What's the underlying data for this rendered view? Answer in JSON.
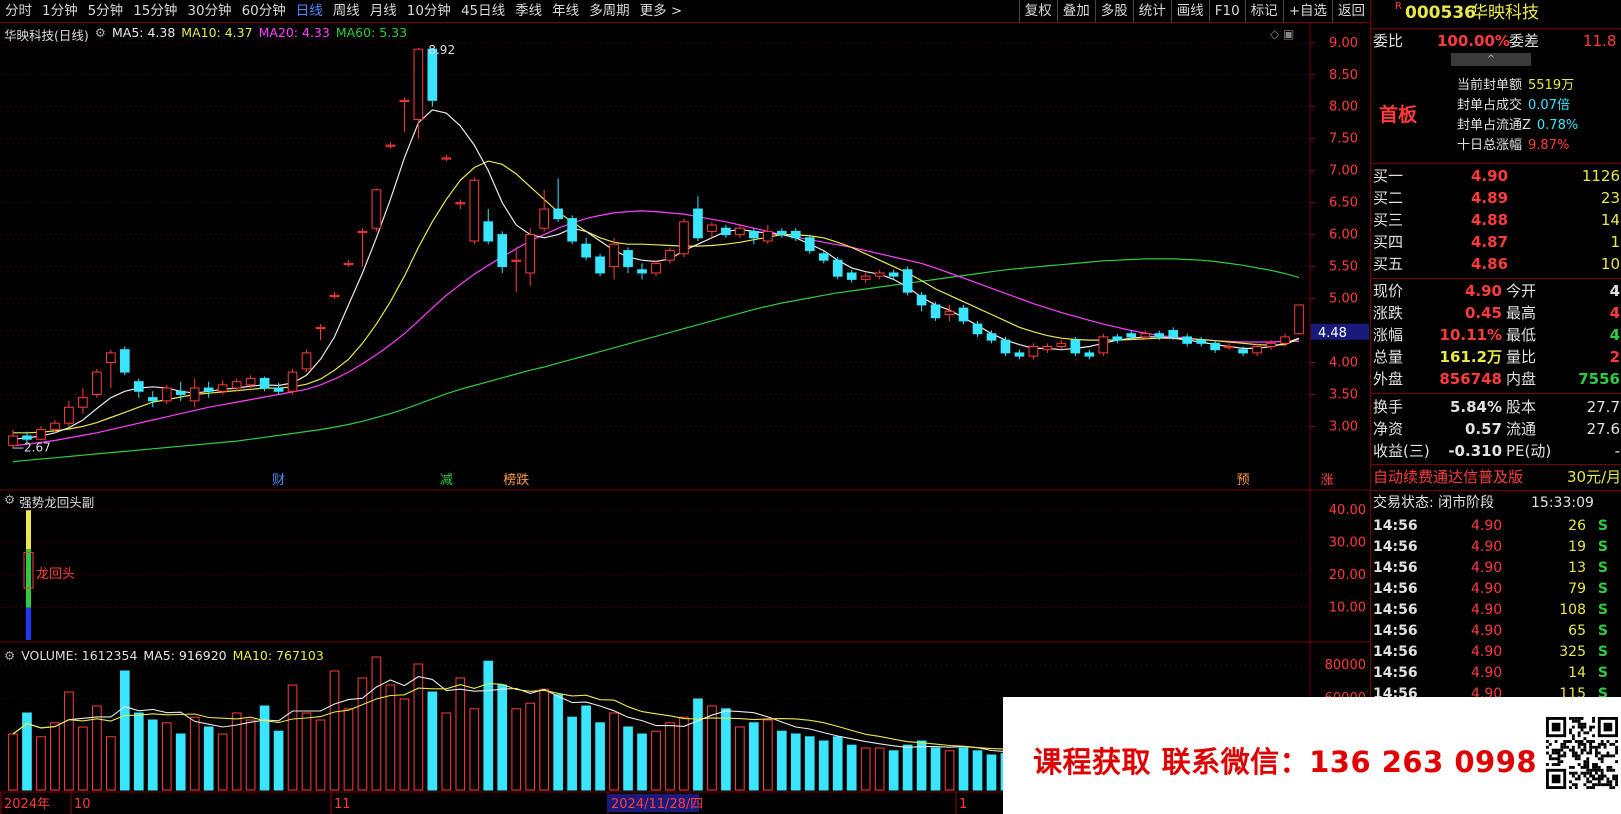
{
  "toolbar": {
    "periods": [
      "分时",
      "1分钟",
      "5分钟",
      "15分钟",
      "30分钟",
      "60分钟",
      "日线",
      "周线",
      "月线",
      "10分钟",
      "45日线",
      "季线",
      "年线",
      "多周期",
      "更多 >"
    ],
    "active_index": 6,
    "right_buttons": [
      "复权",
      "叠加",
      "多股",
      "统计",
      "画线",
      "F10",
      "标记",
      "+自选",
      "返回"
    ]
  },
  "main_chart": {
    "title": "华映科技(日线)",
    "ma_labels": [
      {
        "text": "MA5: 4.38",
        "color": "#e8e8e8"
      },
      {
        "text": "MA10: 4.37",
        "color": "#e8e84a"
      },
      {
        "text": "MA20: 4.33",
        "color": "#ff40ff"
      },
      {
        "text": "MA60: 5.33",
        "color": "#2ecc40"
      }
    ],
    "high_label": "8.92",
    "low_label": "2.67",
    "price_ticks": [
      "9.00",
      "8.50",
      "8.00",
      "7.50",
      "7.00",
      "6.50",
      "6.00",
      "5.50",
      "5.00",
      "4.50",
      "4.00",
      "3.50",
      "3.00"
    ],
    "current_price_tag": "4.48",
    "event_marks": [
      {
        "text": "财",
        "color": "#4a8cff"
      },
      {
        "text": "减",
        "color": "#2ecc40"
      },
      {
        "text": "榜跌",
        "color": "#ff9a40"
      },
      {
        "text": "预",
        "color": "#ff9a40"
      },
      {
        "text": "涨",
        "color": "#ff3b3b"
      }
    ]
  },
  "indicator": {
    "title": "强势龙回头副",
    "signal_label": "龙回头",
    "ticks": [
      "40.00",
      "30.00",
      "20.00",
      "10.00"
    ]
  },
  "volume": {
    "title": "VOLUME: 1612354",
    "ma5": "MA5: 916920",
    "ma10": "MA10: 767103",
    "ticks": [
      "80000",
      "60000"
    ],
    "date_labels": [
      "2024年",
      "10",
      "11",
      "2024/11/28/四",
      "1"
    ]
  },
  "quote": {
    "code": "000536",
    "name": "华映科技",
    "r_mark": "R",
    "weibi_label": "委比",
    "weibi_value": "100.00%",
    "weicha_label": "委差",
    "weicha_value": "11.8",
    "board_label": "首板",
    "seal": [
      {
        "label": "当前封单额",
        "value": "5519万",
        "color": "#e8e84a"
      },
      {
        "label": "封单占成交",
        "value": "0.07倍",
        "color": "#39e5ff"
      },
      {
        "label": "封单占流通Z",
        "value": "0.78%",
        "color": "#39e5ff"
      },
      {
        "label": "十日总涨幅",
        "value": "9.87%",
        "color": "#ff3b3b"
      }
    ],
    "bids": [
      {
        "label": "买一",
        "price": "4.90",
        "vol": "1126"
      },
      {
        "label": "买二",
        "price": "4.89",
        "vol": "23"
      },
      {
        "label": "买三",
        "price": "4.88",
        "vol": "14"
      },
      {
        "label": "买四",
        "price": "4.87",
        "vol": "1"
      },
      {
        "label": "买五",
        "price": "4.86",
        "vol": "10"
      }
    ],
    "stats": [
      {
        "l1": "现价",
        "v1": "4.90",
        "c1": "#ff3b3b",
        "l2": "今开",
        "v2": "4",
        "c2": "#e0e0e0"
      },
      {
        "l1": "涨跌",
        "v1": "0.45",
        "c1": "#ff3b3b",
        "l2": "最高",
        "v2": "4",
        "c2": "#ff3b3b"
      },
      {
        "l1": "涨幅",
        "v1": "10.11%",
        "c1": "#ff3b3b",
        "l2": "最低",
        "v2": "4",
        "c2": "#2ecc40"
      },
      {
        "l1": "总量",
        "v1": "161.2万",
        "c1": "#e8e84a",
        "l2": "量比",
        "v2": "2",
        "c2": "#ff3b3b"
      },
      {
        "l1": "外盘",
        "v1": "856748",
        "c1": "#ff3b3b",
        "l2": "内盘",
        "v2": "7556",
        "c2": "#2ecc40"
      }
    ],
    "stats2": [
      {
        "l1": "换手",
        "v1": "5.84%",
        "l2": "股本",
        "v2": "27.7"
      },
      {
        "l1": "净资",
        "v1": "0.57",
        "l2": "流通",
        "v2": "27.6"
      },
      {
        "l1": "收益(三)",
        "v1": "-0.310",
        "l2": "PE(动)",
        "v2": "-"
      }
    ],
    "ad_text": "自动续费通达信普及版",
    "ad_price": "30元/月",
    "trade_status": "交易状态: 闭市阶段",
    "trade_time": "15:33:09",
    "ticks": [
      {
        "time": "14:56",
        "price": "4.90",
        "vol": "26",
        "side": "S"
      },
      {
        "time": "14:56",
        "price": "4.90",
        "vol": "19",
        "side": "S"
      },
      {
        "time": "14:56",
        "price": "4.90",
        "vol": "13",
        "side": "S"
      },
      {
        "time": "14:56",
        "price": "4.90",
        "vol": "79",
        "side": "S"
      },
      {
        "time": "14:56",
        "price": "4.90",
        "vol": "108",
        "side": "S"
      },
      {
        "time": "14:56",
        "price": "4.90",
        "vol": "65",
        "side": "S"
      },
      {
        "time": "14:56",
        "price": "4.90",
        "vol": "325",
        "side": "S"
      },
      {
        "time": "14:56",
        "price": "4.90",
        "vol": "14",
        "side": "S"
      },
      {
        "time": "14:56",
        "price": "4.90",
        "vol": "115",
        "side": "S"
      }
    ]
  },
  "promo": {
    "text": "课程获取  联系微信：136 263 0998"
  },
  "chart_data": {
    "type": "candlestick",
    "title": "华映科技(日线)",
    "ylim": [
      2.6,
      9.2
    ],
    "candles": [
      {
        "o": 2.7,
        "c": 2.85,
        "h": 2.95,
        "l": 2.67
      },
      {
        "o": 2.85,
        "c": 2.8,
        "h": 2.92,
        "l": 2.75
      },
      {
        "o": 2.8,
        "c": 2.95,
        "h": 3.0,
        "l": 2.78
      },
      {
        "o": 2.95,
        "c": 3.05,
        "h": 3.1,
        "l": 2.9
      },
      {
        "o": 3.05,
        "c": 3.3,
        "h": 3.4,
        "l": 3.0
      },
      {
        "o": 3.3,
        "c": 3.45,
        "h": 3.6,
        "l": 3.2
      },
      {
        "o": 3.5,
        "c": 3.85,
        "h": 3.9,
        "l": 3.45
      },
      {
        "o": 4.0,
        "c": 4.15,
        "h": 4.2,
        "l": 3.6
      },
      {
        "o": 4.2,
        "c": 3.85,
        "h": 4.25,
        "l": 3.8
      },
      {
        "o": 3.7,
        "c": 3.55,
        "h": 3.75,
        "l": 3.45
      },
      {
        "o": 3.45,
        "c": 3.4,
        "h": 3.55,
        "l": 3.3
      },
      {
        "o": 3.4,
        "c": 3.6,
        "h": 3.65,
        "l": 3.35
      },
      {
        "o": 3.55,
        "c": 3.5,
        "h": 3.7,
        "l": 3.4
      },
      {
        "o": 3.4,
        "c": 3.6,
        "h": 3.75,
        "l": 3.3
      },
      {
        "o": 3.6,
        "c": 3.55,
        "h": 3.7,
        "l": 3.45
      },
      {
        "o": 3.55,
        "c": 3.65,
        "h": 3.72,
        "l": 3.5
      },
      {
        "o": 3.6,
        "c": 3.7,
        "h": 3.75,
        "l": 3.55
      },
      {
        "o": 3.65,
        "c": 3.75,
        "h": 3.8,
        "l": 3.6
      },
      {
        "o": 3.75,
        "c": 3.6,
        "h": 3.78,
        "l": 3.55
      },
      {
        "o": 3.6,
        "c": 3.55,
        "h": 3.68,
        "l": 3.5
      },
      {
        "o": 3.55,
        "c": 3.85,
        "h": 3.9,
        "l": 3.5
      },
      {
        "o": 3.9,
        "c": 4.15,
        "h": 4.2,
        "l": 3.85
      },
      {
        "o": 4.55,
        "c": 4.55,
        "h": 4.6,
        "l": 4.35
      },
      {
        "o": 5.05,
        "c": 5.05,
        "h": 5.1,
        "l": 5.0
      },
      {
        "o": 5.55,
        "c": 5.55,
        "h": 5.6,
        "l": 5.5
      },
      {
        "o": 6.05,
        "c": 6.05,
        "h": 6.1,
        "l": 5.5
      },
      {
        "o": 6.1,
        "c": 6.7,
        "h": 6.72,
        "l": 6.05
      },
      {
        "o": 7.4,
        "c": 7.4,
        "h": 7.45,
        "l": 7.35
      },
      {
        "o": 8.1,
        "c": 8.1,
        "h": 8.15,
        "l": 7.6
      },
      {
        "o": 7.8,
        "c": 8.9,
        "h": 8.92,
        "l": 7.5
      },
      {
        "o": 8.9,
        "c": 8.1,
        "h": 8.92,
        "l": 8.0
      },
      {
        "o": 7.2,
        "c": 7.2,
        "h": 7.25,
        "l": 7.15
      },
      {
        "o": 6.5,
        "c": 6.5,
        "h": 6.55,
        "l": 6.4
      },
      {
        "o": 5.9,
        "c": 6.85,
        "h": 6.9,
        "l": 5.85
      },
      {
        "o": 6.2,
        "c": 5.9,
        "h": 6.4,
        "l": 5.85
      },
      {
        "o": 6.0,
        "c": 5.5,
        "h": 6.05,
        "l": 5.4
      },
      {
        "o": 5.6,
        "c": 5.6,
        "h": 5.8,
        "l": 5.1
      },
      {
        "o": 5.4,
        "c": 6.0,
        "h": 6.1,
        "l": 5.2
      },
      {
        "o": 6.1,
        "c": 6.4,
        "h": 6.7,
        "l": 6.05
      },
      {
        "o": 6.4,
        "c": 6.25,
        "h": 6.88,
        "l": 6.2
      },
      {
        "o": 6.25,
        "c": 5.9,
        "h": 6.3,
        "l": 5.85
      },
      {
        "o": 5.85,
        "c": 5.65,
        "h": 5.95,
        "l": 5.6
      },
      {
        "o": 5.65,
        "c": 5.4,
        "h": 5.7,
        "l": 5.35
      },
      {
        "o": 5.5,
        "c": 5.85,
        "h": 5.95,
        "l": 5.3
      },
      {
        "o": 5.75,
        "c": 5.5,
        "h": 5.8,
        "l": 5.4
      },
      {
        "o": 5.45,
        "c": 5.4,
        "h": 5.55,
        "l": 5.3
      },
      {
        "o": 5.4,
        "c": 5.55,
        "h": 5.6,
        "l": 5.35
      },
      {
        "o": 5.6,
        "c": 5.75,
        "h": 5.8,
        "l": 5.55
      },
      {
        "o": 5.7,
        "c": 6.2,
        "h": 6.25,
        "l": 5.65
      },
      {
        "o": 6.4,
        "c": 5.95,
        "h": 6.6,
        "l": 5.9
      },
      {
        "o": 6.05,
        "c": 6.15,
        "h": 6.2,
        "l": 5.95
      },
      {
        "o": 6.1,
        "c": 6.0,
        "h": 6.15,
        "l": 5.95
      },
      {
        "o": 6.0,
        "c": 6.1,
        "h": 6.15,
        "l": 5.95
      },
      {
        "o": 6.05,
        "c": 5.95,
        "h": 6.1,
        "l": 5.85
      },
      {
        "o": 5.9,
        "c": 6.05,
        "h": 6.15,
        "l": 5.85
      },
      {
        "o": 6.05,
        "c": 6.0,
        "h": 6.1,
        "l": 5.95
      },
      {
        "o": 6.05,
        "c": 5.95,
        "h": 6.1,
        "l": 5.9
      },
      {
        "o": 5.95,
        "c": 5.75,
        "h": 6.0,
        "l": 5.7
      },
      {
        "o": 5.7,
        "c": 5.6,
        "h": 5.75,
        "l": 5.55
      },
      {
        "o": 5.6,
        "c": 5.35,
        "h": 5.65,
        "l": 5.3
      },
      {
        "o": 5.4,
        "c": 5.3,
        "h": 5.45,
        "l": 5.25
      },
      {
        "o": 5.3,
        "c": 5.35,
        "h": 5.4,
        "l": 5.25
      },
      {
        "o": 5.35,
        "c": 5.4,
        "h": 5.45,
        "l": 5.3
      },
      {
        "o": 5.4,
        "c": 5.35,
        "h": 5.45,
        "l": 5.3
      },
      {
        "o": 5.45,
        "c": 5.1,
        "h": 5.5,
        "l": 5.05
      },
      {
        "o": 5.05,
        "c": 4.9,
        "h": 5.1,
        "l": 4.8
      },
      {
        "o": 4.9,
        "c": 4.7,
        "h": 4.95,
        "l": 4.65
      },
      {
        "o": 4.75,
        "c": 4.8,
        "h": 4.9,
        "l": 4.65
      },
      {
        "o": 4.85,
        "c": 4.65,
        "h": 4.9,
        "l": 4.6
      },
      {
        "o": 4.6,
        "c": 4.45,
        "h": 4.65,
        "l": 4.4
      },
      {
        "o": 4.45,
        "c": 4.35,
        "h": 4.5,
        "l": 4.3
      },
      {
        "o": 4.35,
        "c": 4.15,
        "h": 4.4,
        "l": 4.1
      },
      {
        "o": 4.15,
        "c": 4.1,
        "h": 4.2,
        "l": 4.05
      },
      {
        "o": 4.1,
        "c": 4.25,
        "h": 4.3,
        "l": 4.05
      },
      {
        "o": 4.2,
        "c": 4.25,
        "h": 4.3,
        "l": 4.15
      },
      {
        "o": 4.25,
        "c": 4.3,
        "h": 4.35,
        "l": 4.2
      },
      {
        "o": 4.35,
        "c": 4.15,
        "h": 4.4,
        "l": 4.1
      },
      {
        "o": 4.15,
        "c": 4.1,
        "h": 4.2,
        "l": 4.05
      },
      {
        "o": 4.15,
        "c": 4.4,
        "h": 4.45,
        "l": 4.1
      },
      {
        "o": 4.4,
        "c": 4.35,
        "h": 4.45,
        "l": 4.3
      },
      {
        "o": 4.45,
        "c": 4.4,
        "h": 4.5,
        "l": 4.35
      },
      {
        "o": 4.4,
        "c": 4.45,
        "h": 4.5,
        "l": 4.35
      },
      {
        "o": 4.45,
        "c": 4.4,
        "h": 4.5,
        "l": 4.35
      },
      {
        "o": 4.5,
        "c": 4.4,
        "h": 4.55,
        "l": 4.35
      },
      {
        "o": 4.4,
        "c": 4.3,
        "h": 4.45,
        "l": 4.25
      },
      {
        "o": 4.35,
        "c": 4.3,
        "h": 4.4,
        "l": 4.25
      },
      {
        "o": 4.3,
        "c": 4.2,
        "h": 4.35,
        "l": 4.15
      },
      {
        "o": 4.25,
        "c": 4.25,
        "h": 4.3,
        "l": 4.2
      },
      {
        "o": 4.2,
        "c": 4.15,
        "h": 4.25,
        "l": 4.1
      },
      {
        "o": 4.15,
        "c": 4.25,
        "h": 4.3,
        "l": 4.1
      },
      {
        "o": 4.25,
        "c": 4.3,
        "h": 4.35,
        "l": 4.2
      },
      {
        "o": 4.3,
        "c": 4.4,
        "h": 4.45,
        "l": 4.25
      },
      {
        "o": 4.45,
        "c": 4.9,
        "h": 4.9,
        "l": 4.44
      }
    ],
    "ma5": [
      2.8,
      2.82,
      2.85,
      2.9,
      2.98,
      3.1,
      3.28,
      3.45,
      3.55,
      3.6,
      3.62,
      3.6,
      3.55,
      3.52,
      3.55,
      3.58,
      3.6,
      3.63,
      3.65,
      3.64,
      3.68,
      3.8,
      4.05,
      4.4,
      4.9,
      5.4,
      5.95,
      6.55,
      7.2,
      7.75,
      7.95,
      7.9,
      7.7,
      7.4,
      7.0,
      6.5,
      6.15,
      6.0,
      5.95,
      6.0,
      6.1,
      6.05,
      5.9,
      5.75,
      5.65,
      5.6,
      5.58,
      5.62,
      5.75,
      5.85,
      5.95,
      6.05,
      6.08,
      6.05,
      6.02,
      6.0,
      5.95,
      5.85,
      5.75,
      5.6,
      5.48,
      5.42,
      5.38,
      5.3,
      5.18,
      5.02,
      4.9,
      4.82,
      4.7,
      4.58,
      4.45,
      4.35,
      4.28,
      4.22,
      4.22,
      4.2,
      4.22,
      4.25,
      4.3,
      4.35,
      4.38,
      4.4,
      4.4,
      4.38,
      4.35,
      4.32,
      4.28,
      4.25,
      4.22,
      4.22,
      4.25,
      4.3,
      4.38
    ],
    "ma10": [
      2.9,
      2.9,
      2.91,
      2.93,
      2.96,
      3.0,
      3.06,
      3.14,
      3.22,
      3.3,
      3.38,
      3.42,
      3.46,
      3.5,
      3.52,
      3.54,
      3.56,
      3.58,
      3.6,
      3.6,
      3.62,
      3.66,
      3.74,
      3.88,
      4.05,
      4.3,
      4.6,
      4.95,
      5.35,
      5.8,
      6.2,
      6.55,
      6.85,
      7.05,
      7.15,
      7.1,
      6.95,
      6.75,
      6.55,
      6.35,
      6.2,
      6.05,
      5.95,
      5.88,
      5.85,
      5.85,
      5.84,
      5.83,
      5.82,
      5.82,
      5.83,
      5.85,
      5.88,
      5.92,
      5.96,
      6.0,
      6.0,
      5.98,
      5.95,
      5.88,
      5.8,
      5.7,
      5.6,
      5.5,
      5.4,
      5.28,
      5.15,
      5.05,
      4.95,
      4.85,
      4.75,
      4.65,
      4.55,
      4.48,
      4.42,
      4.38,
      4.36,
      4.35,
      4.35,
      4.35,
      4.36,
      4.37,
      4.38,
      4.38,
      4.37,
      4.36,
      4.34,
      4.32,
      4.3,
      4.28,
      4.27,
      4.28,
      4.37
    ],
    "ma20": [
      2.7,
      2.72,
      2.75,
      2.78,
      2.82,
      2.86,
      2.9,
      2.95,
      3.0,
      3.05,
      3.1,
      3.15,
      3.2,
      3.25,
      3.3,
      3.34,
      3.38,
      3.42,
      3.46,
      3.5,
      3.54,
      3.58,
      3.65,
      3.74,
      3.85,
      3.98,
      4.12,
      4.28,
      4.45,
      4.65,
      4.85,
      5.05,
      5.22,
      5.38,
      5.52,
      5.65,
      5.78,
      5.9,
      6.0,
      6.1,
      6.18,
      6.25,
      6.3,
      6.34,
      6.36,
      6.37,
      6.36,
      6.34,
      6.32,
      6.28,
      6.24,
      6.2,
      6.15,
      6.1,
      6.05,
      6.0,
      5.96,
      5.92,
      5.88,
      5.84,
      5.8,
      5.75,
      5.7,
      5.65,
      5.6,
      5.55,
      5.48,
      5.4,
      5.32,
      5.24,
      5.16,
      5.08,
      5.0,
      4.92,
      4.85,
      4.78,
      4.72,
      4.66,
      4.6,
      4.55,
      4.5,
      4.46,
      4.42,
      4.4,
      4.38,
      4.36,
      4.34,
      4.33,
      4.32,
      4.32,
      4.32,
      4.33,
      4.33
    ],
    "ma60": [
      2.45,
      2.47,
      2.49,
      2.51,
      2.53,
      2.55,
      2.57,
      2.59,
      2.61,
      2.63,
      2.65,
      2.67,
      2.69,
      2.71,
      2.73,
      2.75,
      2.77,
      2.8,
      2.83,
      2.86,
      2.89,
      2.92,
      2.95,
      2.99,
      3.03,
      3.08,
      3.14,
      3.2,
      3.27,
      3.35,
      3.43,
      3.51,
      3.58,
      3.64,
      3.7,
      3.76,
      3.82,
      3.88,
      3.93,
      3.99,
      4.05,
      4.11,
      4.17,
      4.23,
      4.29,
      4.35,
      4.41,
      4.47,
      4.53,
      4.59,
      4.65,
      4.71,
      4.77,
      4.83,
      4.88,
      4.93,
      4.97,
      5.01,
      5.05,
      5.09,
      5.12,
      5.15,
      5.18,
      5.21,
      5.24,
      5.27,
      5.3,
      5.33,
      5.36,
      5.39,
      5.42,
      5.45,
      5.47,
      5.49,
      5.51,
      5.53,
      5.55,
      5.57,
      5.59,
      5.6,
      5.61,
      5.62,
      5.62,
      5.62,
      5.61,
      5.6,
      5.58,
      5.55,
      5.52,
      5.48,
      5.44,
      5.39,
      5.33
    ],
    "volume": [
      40,
      55,
      38,
      48,
      70,
      45,
      60,
      38,
      85,
      55,
      50,
      48,
      40,
      52,
      45,
      40,
      55,
      50,
      60,
      42,
      75,
      55,
      50,
      85,
      58,
      80,
      95,
      75,
      65,
      90,
      70,
      55,
      80,
      58,
      92,
      75,
      58,
      62,
      72,
      68,
      52,
      60,
      48,
      55,
      45,
      40,
      42,
      48,
      52,
      65,
      60,
      58,
      45,
      48,
      50,
      42,
      40,
      38,
      35,
      38,
      32,
      30,
      30,
      28,
      32,
      35,
      30,
      28,
      30,
      28,
      25,
      26,
      28,
      25,
      24,
      22,
      22,
      20,
      20,
      18,
      18,
      18,
      17,
      17,
      16,
      16,
      15,
      15,
      15,
      15,
      15,
      15,
      15
    ],
    "vol_ylim": [
      0,
      100
    ]
  }
}
